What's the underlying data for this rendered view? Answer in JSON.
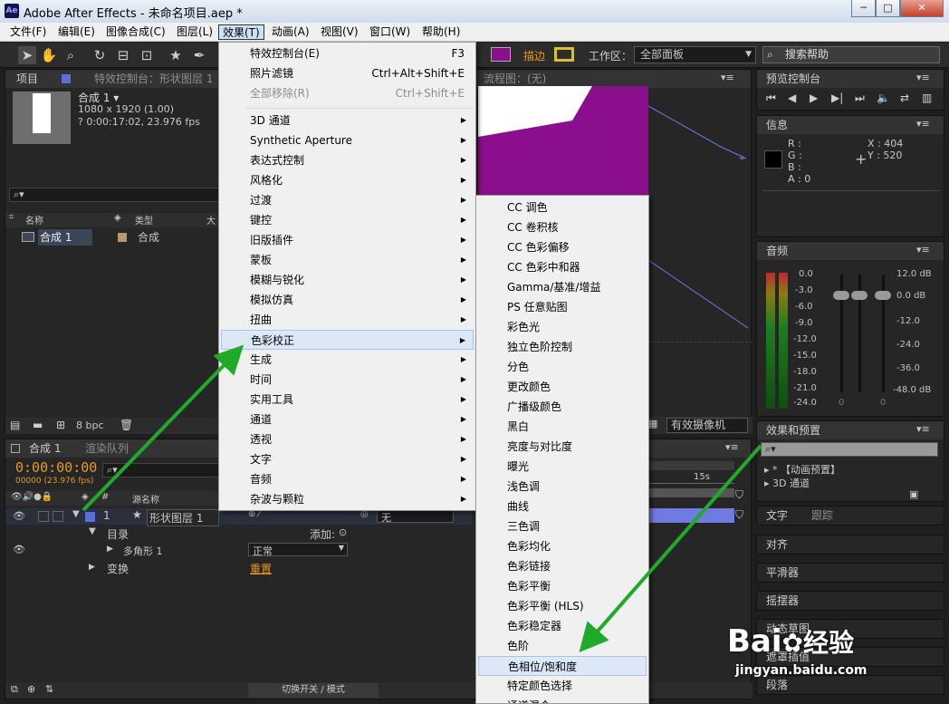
{
  "window": {
    "title": "Adobe After Effects - 未命名项目.aep *",
    "logo": "Ae"
  },
  "window_buttons": {
    "min": "─",
    "max": "□",
    "close": "✕"
  },
  "menubar": {
    "items": [
      "文件(F)",
      "编辑(E)",
      "图像合成(C)",
      "图层(L)",
      "效果(T)",
      "动画(A)",
      "视图(V)",
      "窗口(W)",
      "帮助(H)"
    ]
  },
  "toolbar": {
    "snap_label": "描边",
    "workspace_label": "工作区：",
    "workspace_value": "全部面板",
    "search_help": "搜索帮助"
  },
  "project_panel": {
    "tab": "项目",
    "effects_tab": "特效控制台：形状图层 1",
    "comp_name": "合成 1 ▾",
    "comp_size": "1080 x 1920 (1.00)",
    "comp_duration": "? 0:00:17:02, 23.976 fps",
    "col_name": "名称",
    "col_type": "类型",
    "col_size": "大",
    "item_name": "合成 1",
    "item_type": "合成",
    "bpc": "8 bpc"
  },
  "comp_viewer": {
    "tab": "流程图：(无)",
    "camera": "有效摄像机"
  },
  "preview_panel": {
    "tab": "预览控制台"
  },
  "info_panel": {
    "tab": "信息",
    "r": "R :",
    "g": "G :",
    "b": "B :",
    "a": "A : 0",
    "x": "X : 404",
    "y": "Y : 520"
  },
  "audio_panel": {
    "tab": "音频",
    "left_scale": [
      "0.0",
      "-3.0",
      "-6.0",
      "-9.0",
      "-12.0",
      "-15.0",
      "-18.0",
      "-21.0",
      "-24.0"
    ],
    "right_scale": [
      "12.0 dB",
      "0.0 dB",
      "-12.0",
      "-24.0",
      "-36.0",
      "-48.0 dB"
    ],
    "fader_zero": "0"
  },
  "effects_presets_panel": {
    "tab": "效果和预置",
    "items": [
      "* 【动画预置】",
      "3D 通道"
    ]
  },
  "right_tabs": {
    "text": "文字",
    "track": "跟踪",
    "align": "对齐",
    "smoother": "平滑器",
    "wiggler": "摇摆器",
    "motion_sketch": "动态草图",
    "mask_interp": "遮罩插值",
    "paragraph": "段落"
  },
  "timeline": {
    "tab": "合成 1",
    "render_tab": "渲染队列",
    "timecode": "0:00:00:00",
    "frames": "00000 (23.976 fps)",
    "col_source": "源名称",
    "layer_num": "1",
    "layer_name": "形状图层 1",
    "layer_mode": "无",
    "contents": "目录",
    "add": "添加:",
    "polygon": "多角形 1",
    "polygon_mode": "正常",
    "transform": "变换",
    "reset": "重置",
    "ruler_15s": "15s",
    "toggle": "切换开关 / 模式"
  },
  "effect_menu": {
    "items": [
      {
        "label": "特效控制台(E)",
        "shortcut": "F3"
      },
      {
        "label": "照片滤镜",
        "shortcut": "Ctrl+Alt+Shift+E"
      },
      {
        "label": "全部移除(R)",
        "shortcut": "Ctrl+Shift+E"
      },
      {
        "label": "3D 通道"
      },
      {
        "label": "Synthetic Aperture"
      },
      {
        "label": "表达式控制"
      },
      {
        "label": "风格化"
      },
      {
        "label": "过渡"
      },
      {
        "label": "键控"
      },
      {
        "label": "旧版插件"
      },
      {
        "label": "蒙板"
      },
      {
        "label": "模糊与锐化"
      },
      {
        "label": "模拟仿真"
      },
      {
        "label": "扭曲"
      },
      {
        "label": "色彩校正"
      },
      {
        "label": "生成"
      },
      {
        "label": "时间"
      },
      {
        "label": "实用工具"
      },
      {
        "label": "通道"
      },
      {
        "label": "透视"
      },
      {
        "label": "文字"
      },
      {
        "label": "音频"
      },
      {
        "label": "杂波与颗粒"
      }
    ]
  },
  "color_menu": {
    "items": [
      "CC 调色",
      "CC 卷积核",
      "CC 色彩偏移",
      "CC 色彩中和器",
      "Gamma/基准/增益",
      "PS 任意贴图",
      "彩色光",
      "独立色阶控制",
      "分色",
      "更改颜色",
      "广播级颜色",
      "黑白",
      "亮度与对比度",
      "曝光",
      "浅色调",
      "曲线",
      "三色调",
      "色彩均化",
      "色彩链接",
      "色彩平衡",
      "色彩平衡 (HLS)",
      "色彩稳定器",
      "色阶",
      "色相位/饱和度",
      "特定颜色选择",
      "通道混合"
    ]
  },
  "watermark": {
    "brand": "Bai",
    "brand2": "经验",
    "url": "jingyan.baidu.com"
  },
  "colors": {
    "accent_orange": "#e89a1d",
    "shape_purple": "#8b0f8c",
    "arrow_green": "#1faa2a"
  }
}
